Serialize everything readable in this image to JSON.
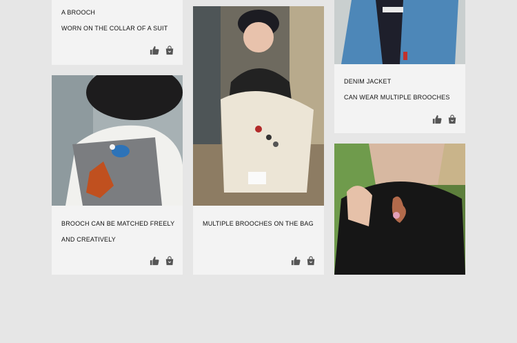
{
  "cards": [
    {
      "line1": "A BROOCH",
      "line2": "WORN ON THE COLLAR OF A SUIT"
    },
    {
      "line1": "BROOCH CAN BE MATCHED FREELY",
      "line2": "AND CREATIVELY"
    },
    {
      "line1": "MULTIPLE BROOCHES ON THE BAG",
      "line2": ""
    },
    {
      "line1": "DENIM JACKET",
      "line2": "CAN WEAR MULTIPLE BROOCHES"
    }
  ],
  "icons": {
    "like": "thumbs-up-icon",
    "shop": "shopping-bag-icon"
  },
  "colors": {
    "background": "#e6e6e6",
    "card": "#f3f3f3",
    "text": "#111111",
    "icon": "#555555"
  }
}
